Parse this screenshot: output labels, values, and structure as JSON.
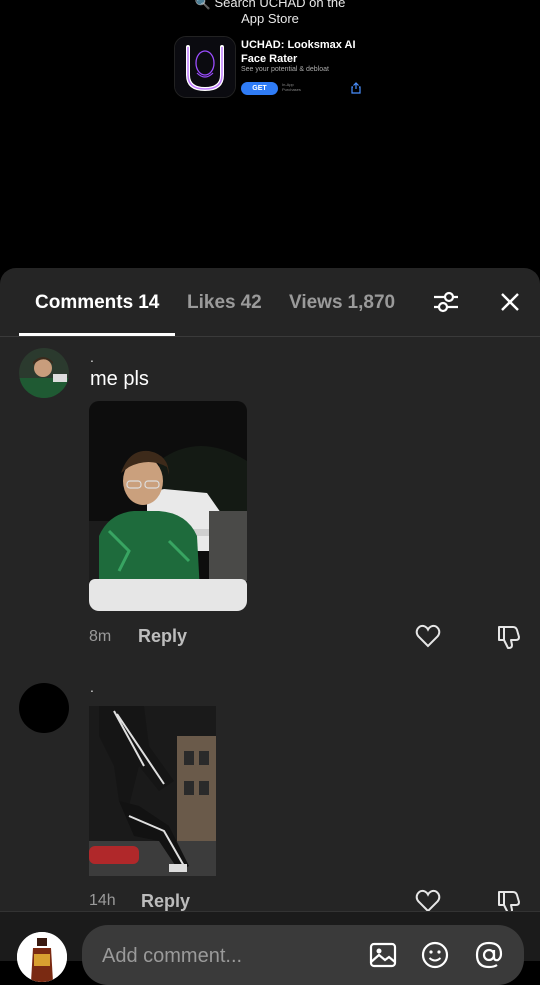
{
  "store_banner": {
    "line1": "Search UCHAD on the",
    "line2": "App Store",
    "app_title_line1": "UCHAD: Looksmax AI",
    "app_title_line2": "Face Rater",
    "app_subtitle": "See your potential & debloat",
    "get_label": "GET",
    "get_note": "In-App Purchases"
  },
  "tabs": [
    {
      "label": "Comments",
      "count": "14",
      "active": true
    },
    {
      "label": "Likes",
      "count": "42",
      "active": false
    },
    {
      "label": "Views",
      "count": "1,870",
      "active": false
    }
  ],
  "comments": [
    {
      "username": ".",
      "text": "me pls",
      "time": "8m",
      "reply_label": "Reply",
      "has_image": true
    },
    {
      "username": ".",
      "text": "",
      "time": "14h",
      "reply_label": "Reply",
      "has_image": true
    }
  ],
  "composer": {
    "placeholder": "Add comment..."
  },
  "colors": {
    "sheet_bg": "#252525",
    "accent_blue": "#2f7cf6",
    "inactive_text": "#9a9a9a"
  },
  "icons": [
    "search-icon",
    "app-logo-icon",
    "share-icon",
    "filter-icon",
    "close-icon",
    "heart-icon",
    "dislike-icon",
    "image-icon",
    "emoji-icon",
    "at-icon"
  ]
}
